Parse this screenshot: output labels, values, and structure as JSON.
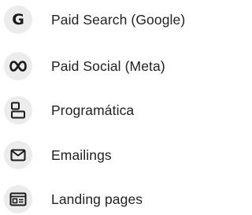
{
  "channels": [
    {
      "label": "Paid Search (Google)",
      "icon": "google-icon"
    },
    {
      "label": "Paid Social (Meta)",
      "icon": "meta-icon"
    },
    {
      "label": "Programática",
      "icon": "programmatic-icon"
    },
    {
      "label": "Emailings",
      "icon": "mail-icon"
    },
    {
      "label": "Landing pages",
      "icon": "landing-page-icon"
    }
  ],
  "colors": {
    "icon_bg": "#ececec",
    "icon_fg": "#1a1a1a",
    "text": "#222222"
  }
}
